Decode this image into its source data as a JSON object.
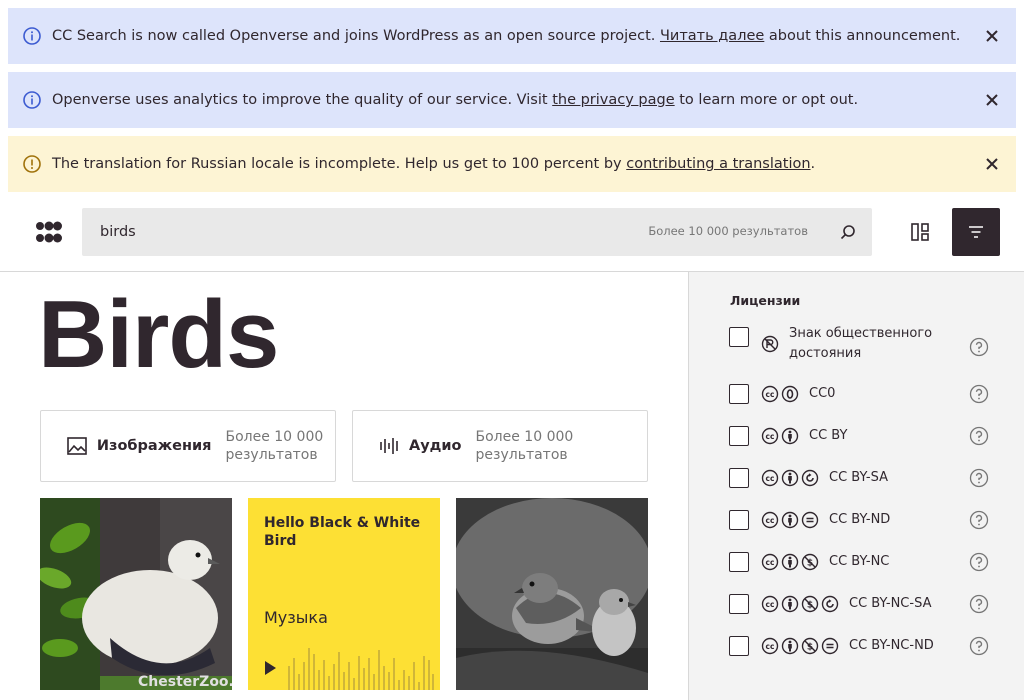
{
  "banners": [
    {
      "pre": "CC Search is now called Openverse and joins WordPress as an open source project. ",
      "link": "Читать далее",
      "post": " about this announcement."
    },
    {
      "pre": "Openverse uses analytics to improve the quality of our service. Visit ",
      "link": "the privacy page",
      "post": " to learn more or opt out."
    },
    {
      "pre": "The translation for Russian locale is incomplete. Help us get to 100 percent by ",
      "link": "contributing a translation",
      "post": "."
    }
  ],
  "search": {
    "value": "birds",
    "count": "Более 10 000 результатов"
  },
  "page_title": "Birds",
  "media_tabs": [
    {
      "label": "Изображения",
      "count": "Более 10 000 результатов",
      "icon": "image-icon"
    },
    {
      "label": "Аудио",
      "count": "Более 10 000 результатов",
      "icon": "audio-icon"
    }
  ],
  "audio_card": {
    "title": "Hello Black & White Bird",
    "genre": "Музыка"
  },
  "sidebar": {
    "title": "Лицензии",
    "licenses": [
      {
        "label": "Знак общественного достояния",
        "icons": [
          "pdm"
        ]
      },
      {
        "label": "CC0",
        "icons": [
          "cc",
          "zero"
        ]
      },
      {
        "label": "CC BY",
        "icons": [
          "cc",
          "by"
        ]
      },
      {
        "label": "CC BY-SA",
        "icons": [
          "cc",
          "by",
          "sa"
        ]
      },
      {
        "label": "CC BY-ND",
        "icons": [
          "cc",
          "by",
          "nd"
        ]
      },
      {
        "label": "CC BY-NC",
        "icons": [
          "cc",
          "by",
          "nc"
        ]
      },
      {
        "label": "CC BY-NC-SA",
        "icons": [
          "cc",
          "by",
          "nc",
          "sa"
        ]
      },
      {
        "label": "CC BY-NC-ND",
        "icons": [
          "cc",
          "by",
          "nc",
          "nd"
        ]
      }
    ]
  },
  "watermark": "ChesterZoo.",
  "colors": {
    "info_banner": "#dde4fb",
    "warn_banner": "#fdf4d4",
    "audio_card": "#fde034",
    "dark": "#30272e"
  }
}
